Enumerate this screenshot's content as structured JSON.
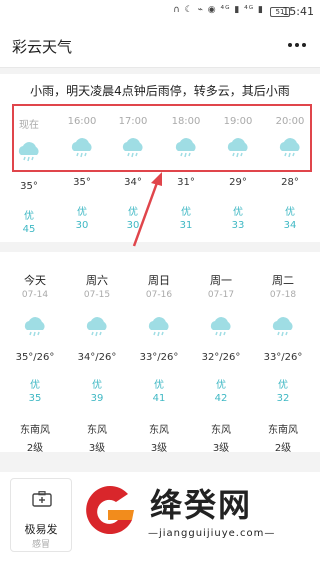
{
  "status_bar": {
    "icons": "∩ ☾ ⌁ ◉ ⁴ᴳ ▮ ⁴ᴳ ▮",
    "battery": "51",
    "time": "15:41"
  },
  "app": {
    "title": "彩云天气",
    "more_icon": "more-dots-icon"
  },
  "summary": "小雨，明天凌晨4点钟后雨停，转多云，其后小雨",
  "hourly": [
    {
      "time": "现在",
      "icon": "light-rain-cloud-icon",
      "temp": "35°",
      "aqi_label": "优",
      "aqi": "45"
    },
    {
      "time": "16:00",
      "icon": "light-rain-cloud-icon",
      "temp": "35°",
      "aqi_label": "优",
      "aqi": "30"
    },
    {
      "time": "17:00",
      "icon": "light-rain-cloud-icon",
      "temp": "34°",
      "aqi_label": "优",
      "aqi": "30"
    },
    {
      "time": "18:00",
      "icon": "light-rain-cloud-icon",
      "temp": "31°",
      "aqi_label": "优",
      "aqi": "31"
    },
    {
      "time": "19:00",
      "icon": "light-rain-cloud-icon",
      "temp": "29°",
      "aqi_label": "优",
      "aqi": "33"
    },
    {
      "time": "20:00",
      "icon": "light-rain-cloud-icon",
      "temp": "28°",
      "aqi_label": "优",
      "aqi": "34"
    }
  ],
  "daily": [
    {
      "day": "今天",
      "date": "07-14",
      "icon": "light-rain-cloud-icon",
      "range": "35°/26°",
      "aqi_label": "优",
      "aqi": "35",
      "wind": "东南风",
      "level": "2级"
    },
    {
      "day": "周六",
      "date": "07-15",
      "icon": "light-rain-cloud-icon",
      "range": "34°/26°",
      "aqi_label": "优",
      "aqi": "39",
      "wind": "东风",
      "level": "3级"
    },
    {
      "day": "周日",
      "date": "07-16",
      "icon": "light-rain-cloud-icon",
      "range": "33°/26°",
      "aqi_label": "优",
      "aqi": "41",
      "wind": "东风",
      "level": "3级"
    },
    {
      "day": "周一",
      "date": "07-17",
      "icon": "light-rain-cloud-icon",
      "range": "32°/26°",
      "aqi_label": "优",
      "aqi": "42",
      "wind": "东风",
      "level": "3级"
    },
    {
      "day": "周二",
      "date": "07-18",
      "icon": "light-rain-cloud-icon",
      "range": "33°/26°",
      "aqi_label": "优",
      "aqi": "32",
      "wind": "东南风",
      "level": "2级"
    }
  ],
  "life_tile": {
    "icon": "first-aid-kit-icon",
    "label": "极易发",
    "sub": "感冒"
  },
  "watermark": {
    "name": "绛癸网",
    "url": "—jiangguijiuye.com—"
  },
  "colors": {
    "aqi": "#3fb8c4",
    "cloud": "#9fdde4",
    "highlight_box": "#e0454b",
    "watermark_red": "#d9262b",
    "watermark_orange": "#f28c1c"
  }
}
